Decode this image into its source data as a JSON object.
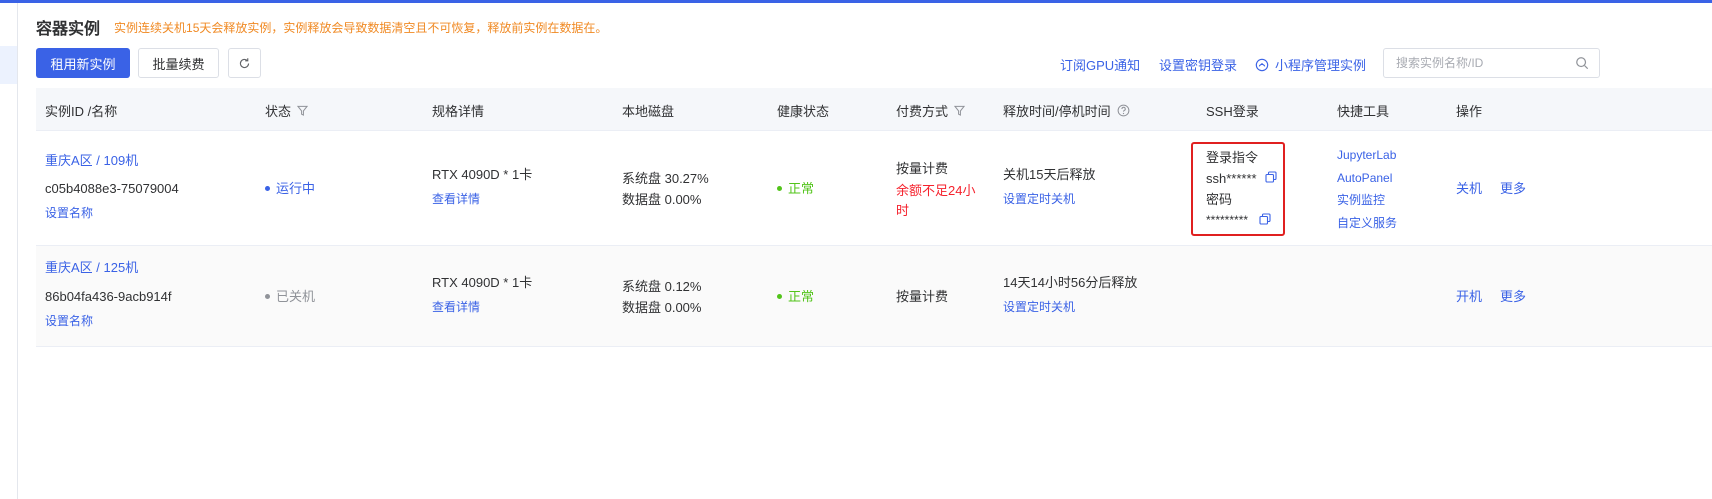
{
  "header": {
    "title": "容器实例",
    "notice": "实例连续关机15天会释放实例，实例释放会导致数据清空且不可恢复，释放前实例在数据在。"
  },
  "toolbar": {
    "rent_label": "租用新实例",
    "renew_label": "批量续费",
    "subscribe_gpu": "订阅GPU通知",
    "key_login": "设置密钥登录",
    "mini_program": "小程序管理实例",
    "search_placeholder": "搜索实例名称/ID"
  },
  "table": {
    "columns": [
      "实例ID /名称",
      "状态",
      "规格详情",
      "本地磁盘",
      "健康状态",
      "付费方式",
      "释放时间/停机时间",
      "SSH登录",
      "快捷工具",
      "操作"
    ],
    "rows": [
      {
        "region": "重庆A区 / 109机",
        "id": "c05b4088e3-75079004",
        "set_name": "设置名称",
        "status": "运行中",
        "spec": "RTX 4090D * 1卡",
        "spec_detail": "查看详情",
        "disk_system": "系统盘 30.27%",
        "disk_data": "数据盘 0.00%",
        "health": "正常",
        "billing": "按量计费",
        "billing_warning": "余额不足24小时",
        "release": "关机15天后释放",
        "release_link": "设置定时关机",
        "ssh_cmd_label": "登录指令",
        "ssh_cmd": "ssh******",
        "ssh_pwd_label": "密码",
        "ssh_pwd": "*********",
        "tools": [
          "JupyterLab",
          "AutoPanel",
          "实例监控",
          "自定义服务"
        ],
        "action_power": "关机",
        "action_more": "更多"
      },
      {
        "region": "重庆A区 / 125机",
        "id": "86b04fa436-9acb914f",
        "set_name": "设置名称",
        "status": "已关机",
        "spec": "RTX 4090D * 1卡",
        "spec_detail": "查看详情",
        "disk_system": "系统盘 0.12%",
        "disk_data": "数据盘 0.00%",
        "health": "正常",
        "billing": "按量计费",
        "release": "14天14小时56分后释放",
        "release_link": "设置定时关机",
        "action_power": "开机",
        "action_more": "更多"
      }
    ]
  },
  "colors": {
    "primary": "#3a62e6",
    "warning": "#f08a24",
    "danger": "#f5222d",
    "success": "#52c41a",
    "muted": "#909399"
  }
}
